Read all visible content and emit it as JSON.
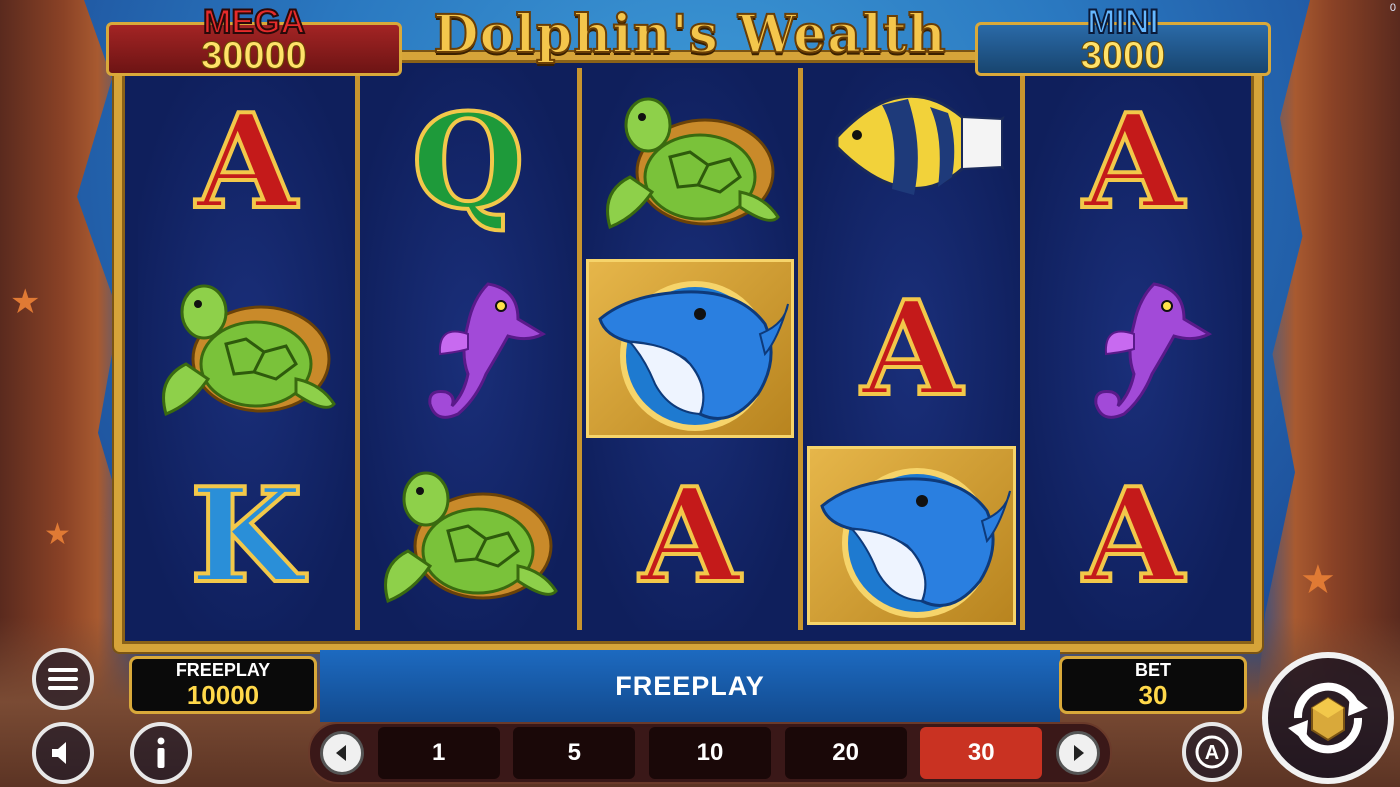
{
  "game": {
    "title": "Dolphin's Wealth",
    "corner_counter": "0"
  },
  "jackpots": {
    "mega": {
      "label": "MEGA",
      "value": "30000"
    },
    "mini": {
      "label": "MINI",
      "value": "3000"
    }
  },
  "reels": [
    [
      "A",
      "turtle",
      "K"
    ],
    [
      "Q",
      "seahorse",
      "turtle"
    ],
    [
      "turtle",
      "dolphin",
      "A"
    ],
    [
      "angelfish",
      "A",
      "dolphin"
    ],
    [
      "A",
      "seahorse",
      "A"
    ]
  ],
  "symbols_style": {
    "A": "red",
    "Q": "green",
    "K": "blue"
  },
  "balance": {
    "label": "FREEPLAY",
    "value": "10000"
  },
  "status_message": "FREEPLAY",
  "bet": {
    "label": "BET",
    "value": "30"
  },
  "bet_options": [
    "1",
    "5",
    "10",
    "20",
    "30"
  ],
  "selected_bet": "30",
  "icons": {
    "menu": "hamburger-menu-icon",
    "sound": "speaker-icon",
    "info": "info-icon",
    "autoplay": "autoplay-icon",
    "spin": "spin-icon",
    "prev": "chevron-left-icon",
    "next": "chevron-right-icon"
  },
  "colors": {
    "gold": "#d9a93a",
    "selected_bet": "#c93222",
    "value_yellow": "#ffd84a"
  }
}
